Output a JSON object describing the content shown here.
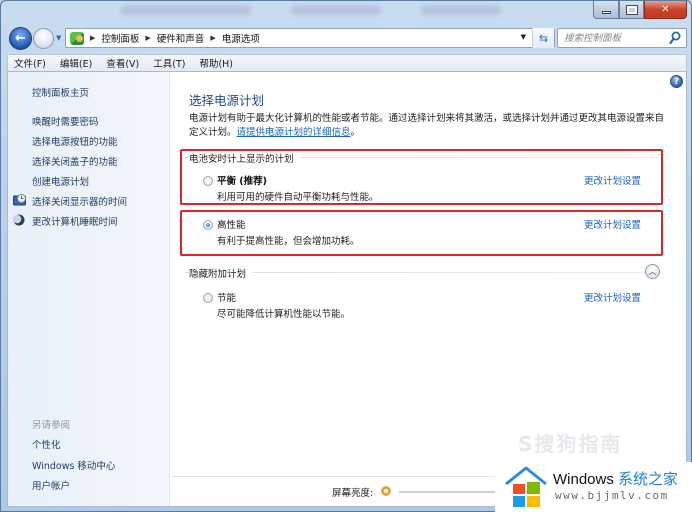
{
  "window": {
    "controls": {
      "minimize": "minimize",
      "maximize": "maximize",
      "close": "close"
    }
  },
  "navbar": {
    "breadcrumb": [
      "控制面板",
      "硬件和声音",
      "电源选项"
    ],
    "search_placeholder": "搜索控制面板"
  },
  "menubar": {
    "items": [
      "文件(F)",
      "编辑(E)",
      "查看(V)",
      "工具(T)",
      "帮助(H)"
    ]
  },
  "sidebar": {
    "home": "控制面板主页",
    "links": [
      {
        "label": "唤醒时需要密码",
        "icon": null
      },
      {
        "label": "选择电源按钮的功能",
        "icon": null
      },
      {
        "label": "选择关闭盖子的功能",
        "icon": null
      },
      {
        "label": "创建电源计划",
        "icon": null
      },
      {
        "label": "选择关闭显示器的时间",
        "icon": "monitor-clock-icon"
      },
      {
        "label": "更改计算机睡眠时间",
        "icon": "moon-icon"
      }
    ],
    "see_also": {
      "heading": "另请参阅",
      "links": [
        "个性化",
        "Windows 移动中心",
        "用户帐户"
      ]
    }
  },
  "main": {
    "title": "选择电源计划",
    "intro": "电源计划有助于最大化计算机的性能或者节能。通过选择计划来将其激活，或选择计划并通过更改其电源设置来自定义计划。",
    "intro_link": "请提供电源计划的详细信息",
    "intro_end": "。",
    "battery_group_label": "电池安时计上显示的计划",
    "hidden_group_label": "隐藏附加计划",
    "plans": [
      {
        "name": "平衡 (推荐)",
        "description": "利用可用的硬件自动平衡功耗与性能。",
        "link": "更改计划设置",
        "selected": false
      },
      {
        "name": "高性能",
        "description": "有利于提高性能，但会增加功耗。",
        "link": "更改计划设置",
        "selected": true
      },
      {
        "name": "节能",
        "description": "尽可能降低计算机性能以节能。",
        "link": "更改计划设置",
        "selected": false
      }
    ],
    "footer": {
      "brightness_label": "屏幕亮度:"
    }
  },
  "colors": {
    "highlight": "#e0242a",
    "link": "#1b62c6",
    "title": "#1c4a9a"
  },
  "watermarks": {
    "sogou": "S搜狗指南",
    "brand_title_en": "Windows",
    "brand_title_cn": "系统之家",
    "brand_url": "www.bjjmlv.com"
  }
}
